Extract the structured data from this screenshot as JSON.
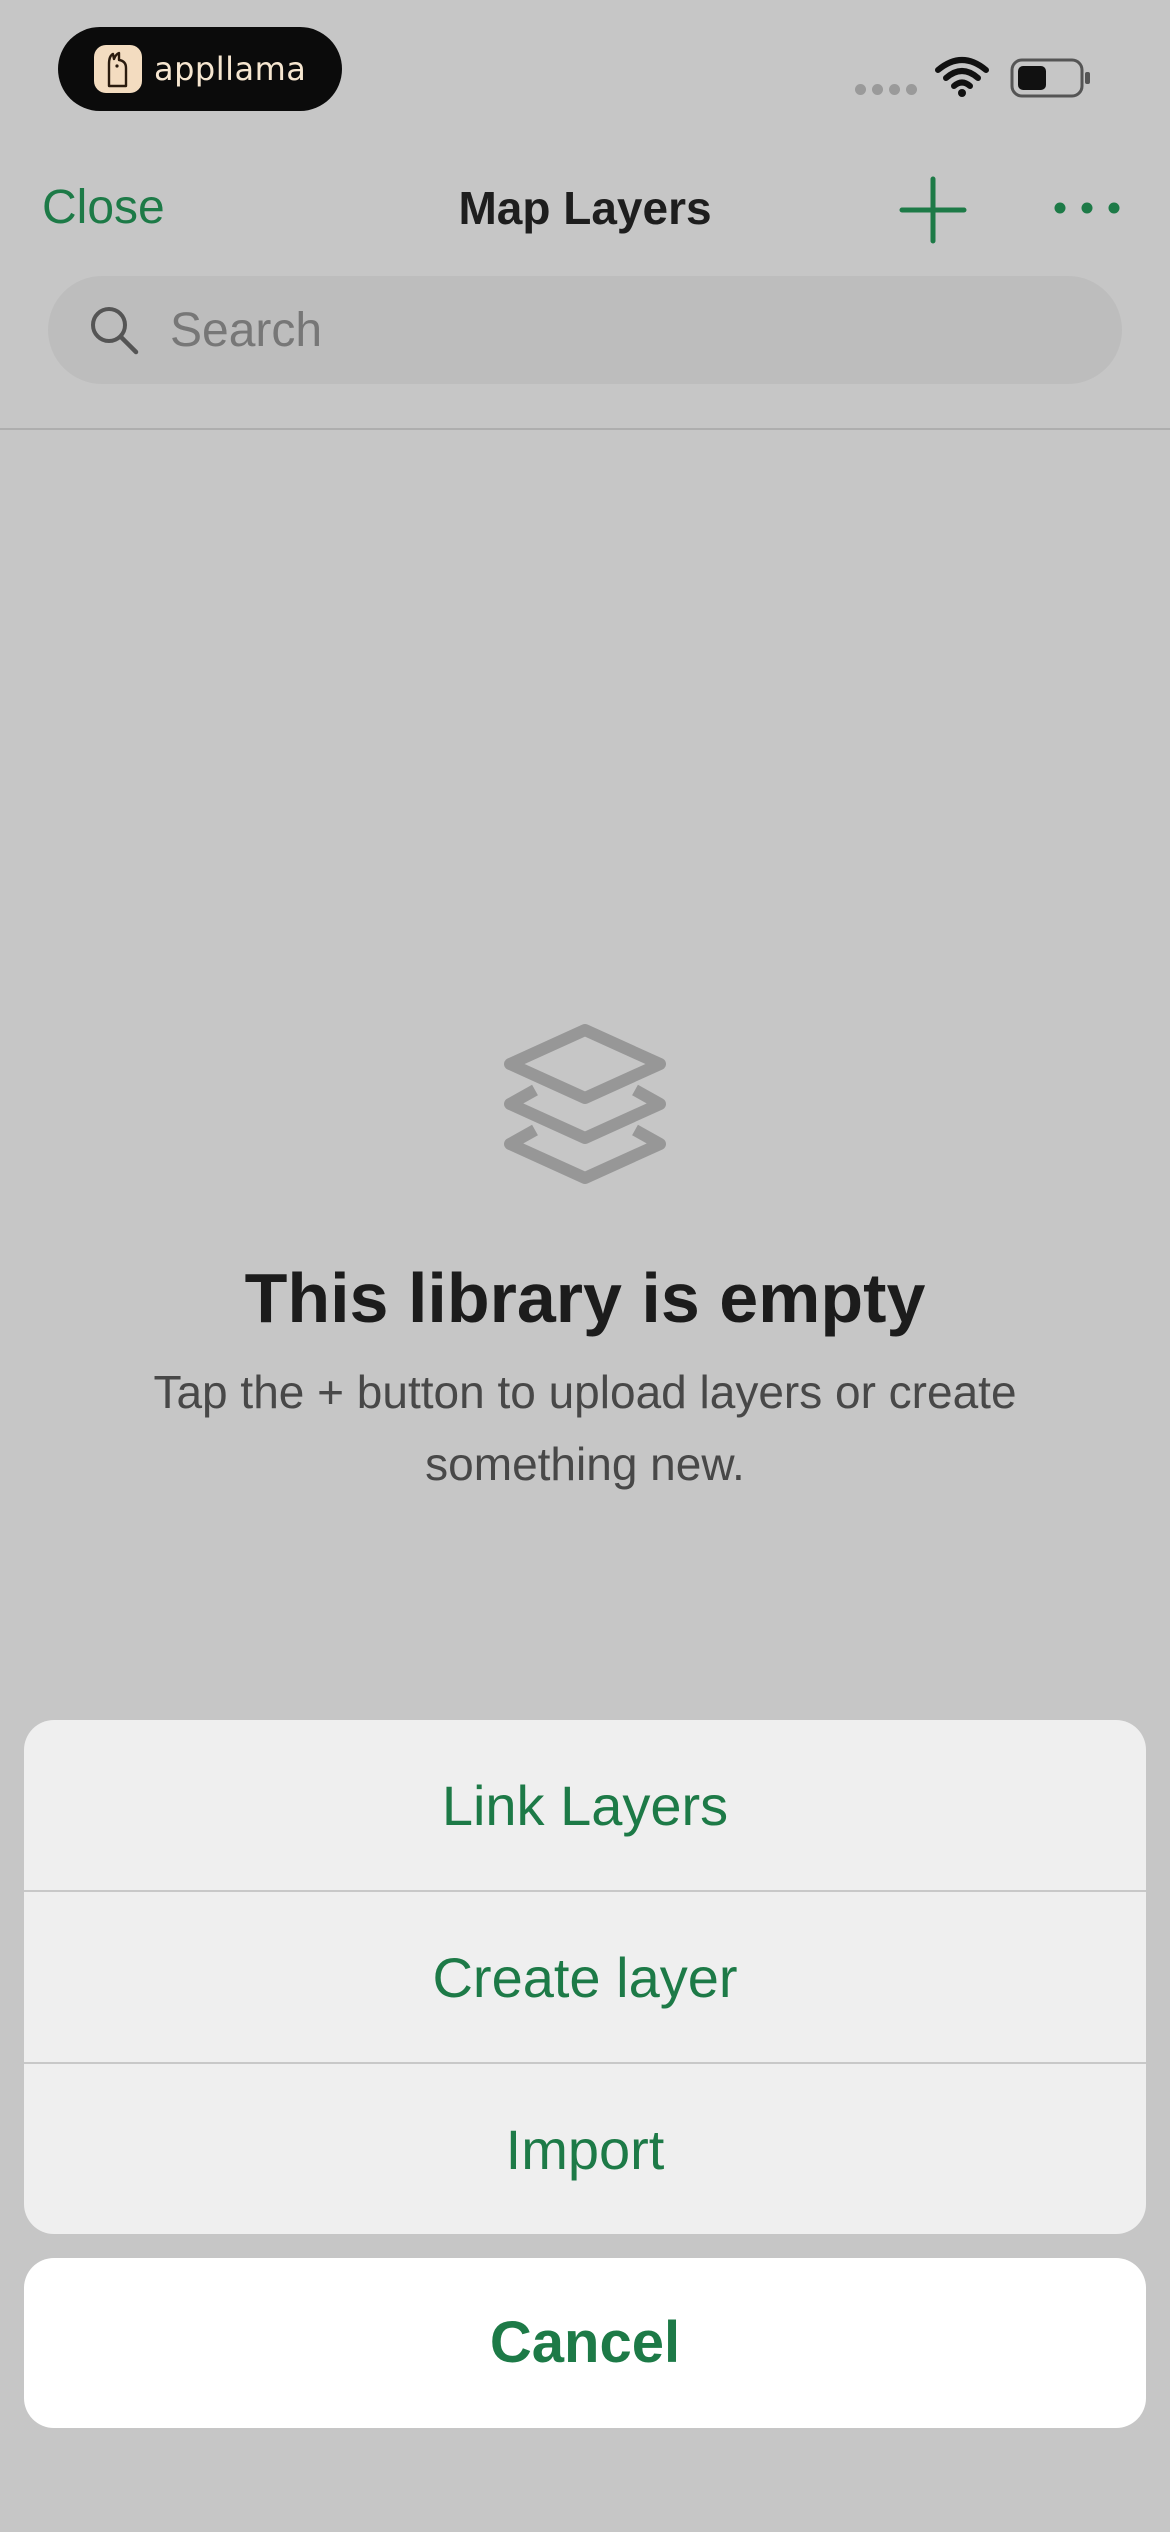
{
  "status_bar": {
    "app_badge": "appllama",
    "icons": [
      "signal-dots-icon",
      "wifi-icon",
      "battery-icon"
    ]
  },
  "header": {
    "close_label": "Close",
    "title": "Map Layers",
    "add_icon": "plus-icon",
    "more_icon": "ellipsis-icon"
  },
  "search": {
    "placeholder": "Search",
    "value": ""
  },
  "empty_state": {
    "icon": "layers-icon",
    "title": "This library is empty",
    "subtitle": "Tap the + button to upload layers or create something new."
  },
  "action_sheet": {
    "items": [
      {
        "label": "Link Layers"
      },
      {
        "label": "Create layer"
      },
      {
        "label": "Import"
      }
    ],
    "cancel_label": "Cancel"
  },
  "colors": {
    "accent": "#1d7a47",
    "background_dim": "#c6c6c6",
    "sheet": "#efefef"
  }
}
